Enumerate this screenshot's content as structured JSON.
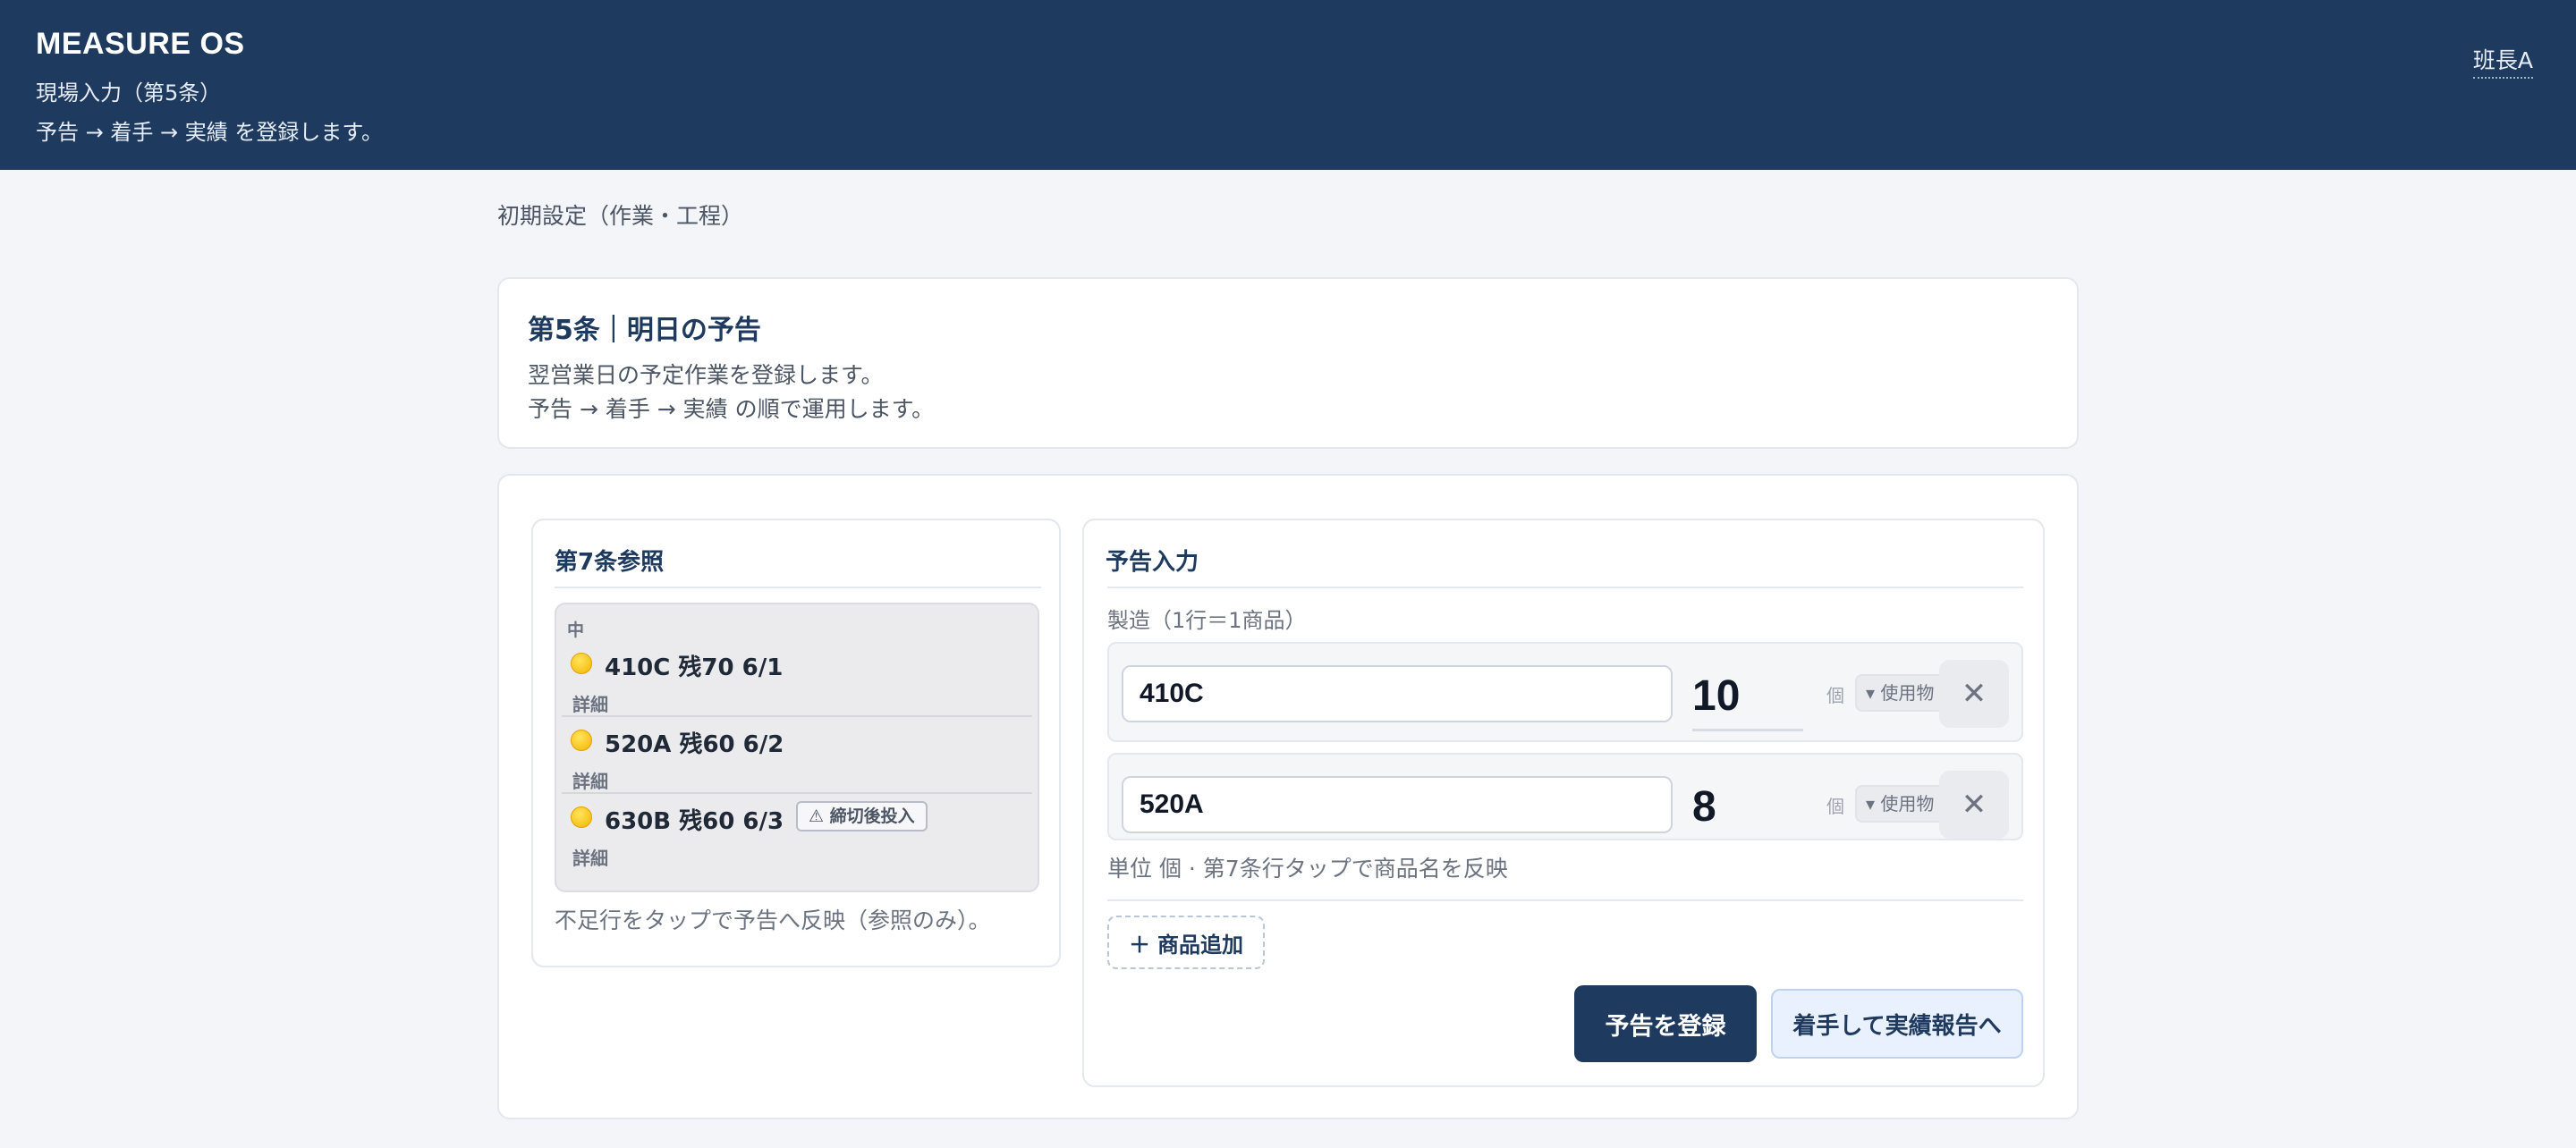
{
  "header": {
    "app_title": "MEASURE OS",
    "subtitle": "現場入力（第5条）",
    "description": "予告 → 着手 → 実績 を登録します。",
    "user": "班長A"
  },
  "breadcrumb": "初期設定（作業・工程）",
  "intro": {
    "title": "第5条｜明日の予告",
    "line1": "翌営業日の予定作業を登録します。",
    "line2": "予告 → 着手 → 実績 の順で運用します。"
  },
  "reference": {
    "title": "第7条参照",
    "category": "中",
    "items": [
      {
        "text": "410C 残70 6/1",
        "detail": "詳細",
        "badge": ""
      },
      {
        "text": "520A 残60 6/2",
        "detail": "詳細",
        "badge": ""
      },
      {
        "text": "630B 残60 6/3",
        "detail": "詳細",
        "badge": "⚠ 締切後投入"
      }
    ],
    "note": "不足行をタップで予告へ反映（参照のみ）。"
  },
  "forecast": {
    "title": "予告入力",
    "section_label": "製造（1行＝1商品）",
    "rows": [
      {
        "product": "410C",
        "qty": "10",
        "unit": "個",
        "material": "▾ 使用物"
      },
      {
        "product": "520A",
        "qty": "8",
        "unit": "個",
        "material": "▾ 使用物"
      }
    ],
    "hint": "単位 個 · 第7条行タップで商品名を反映",
    "add_label": "商品追加",
    "register_label": "予告を登録",
    "start_label": "着手して実績報告へ"
  },
  "icons": {
    "status_dot": "yellow-circle-icon",
    "remove": "close-icon",
    "add": "plus-icon",
    "warning": "warning-icon"
  },
  "colors": {
    "header_bg": "#1f3a5f",
    "primary": "#1f3a5f",
    "status_yellow": "#f4b400",
    "secondary_bg": "#e8f1fd"
  }
}
